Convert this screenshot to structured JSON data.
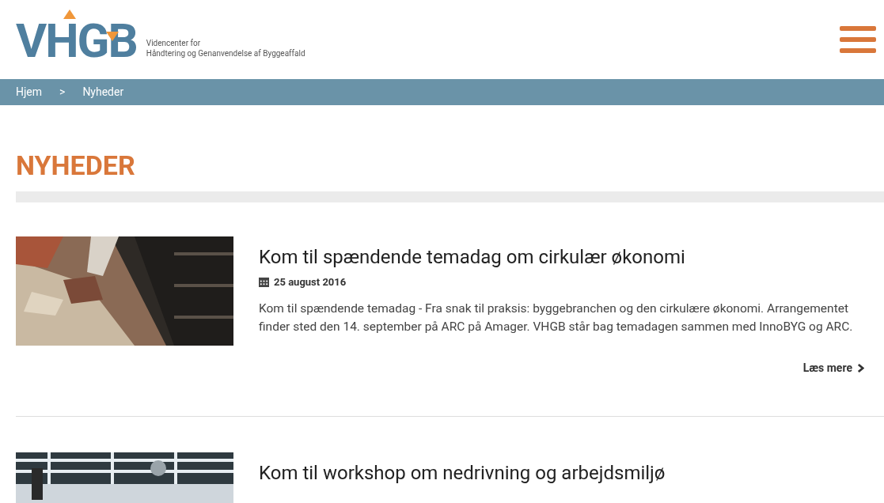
{
  "logo": {
    "text": "VHGB",
    "tagline_1": "Videncenter for",
    "tagline_2": "Håndtering og Genanvendelse af Byggeaffald"
  },
  "breadcrumb": [
    {
      "label": "Hjem"
    },
    {
      "label": ">"
    },
    {
      "label": "Nyheder"
    }
  ],
  "page_title": "NYHEDER",
  "articles": [
    {
      "title": "Kom til spændende temadag om cirkulær økonomi",
      "date": "25 august 2016",
      "body": "Kom til spændende temadag - Fra snak til praksis: byggebranchen og den cirkulære økonomi. Arrangementet finder sted den 14. september på ARC på Amager. VHGB står bag temadagen sammen med InnoBYG og ARC.",
      "link": "Læs mere",
      "kind": "picture"
    },
    {
      "title": "Kom til workshop om nedrivning og arbejdsmiljø",
      "kind": "picture"
    }
  ]
}
